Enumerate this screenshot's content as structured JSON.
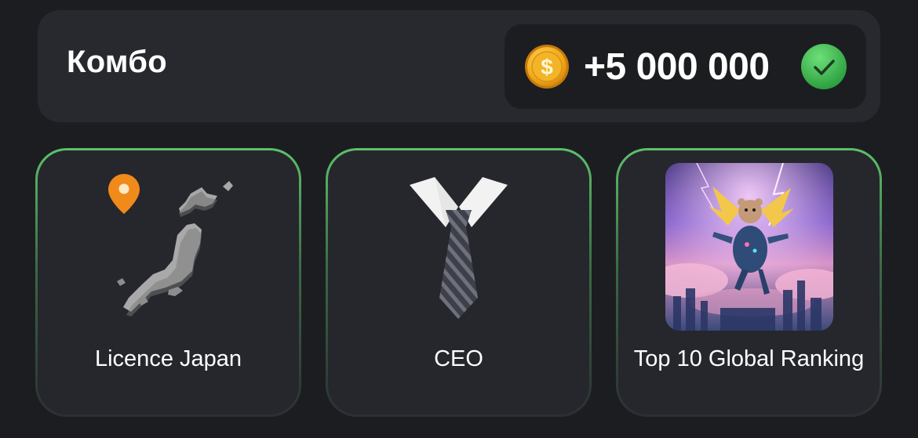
{
  "combo": {
    "title": "Комбо",
    "reward": "+5 000 000",
    "reward_icon": "coin-icon",
    "claimed_icon": "check-circle-icon",
    "colors": {
      "panel": "#27292e",
      "pill": "#1c1d21",
      "coin": "#f5b21c",
      "check": "#3bb54a",
      "card_border": "#5cc26a"
    }
  },
  "cards": [
    {
      "label": "Licence Japan",
      "icon": "japan-map-icon"
    },
    {
      "label": "CEO",
      "icon": "necktie-icon"
    },
    {
      "label": "Top 10 Global Ranking",
      "icon": "flying-hamster-image"
    }
  ]
}
